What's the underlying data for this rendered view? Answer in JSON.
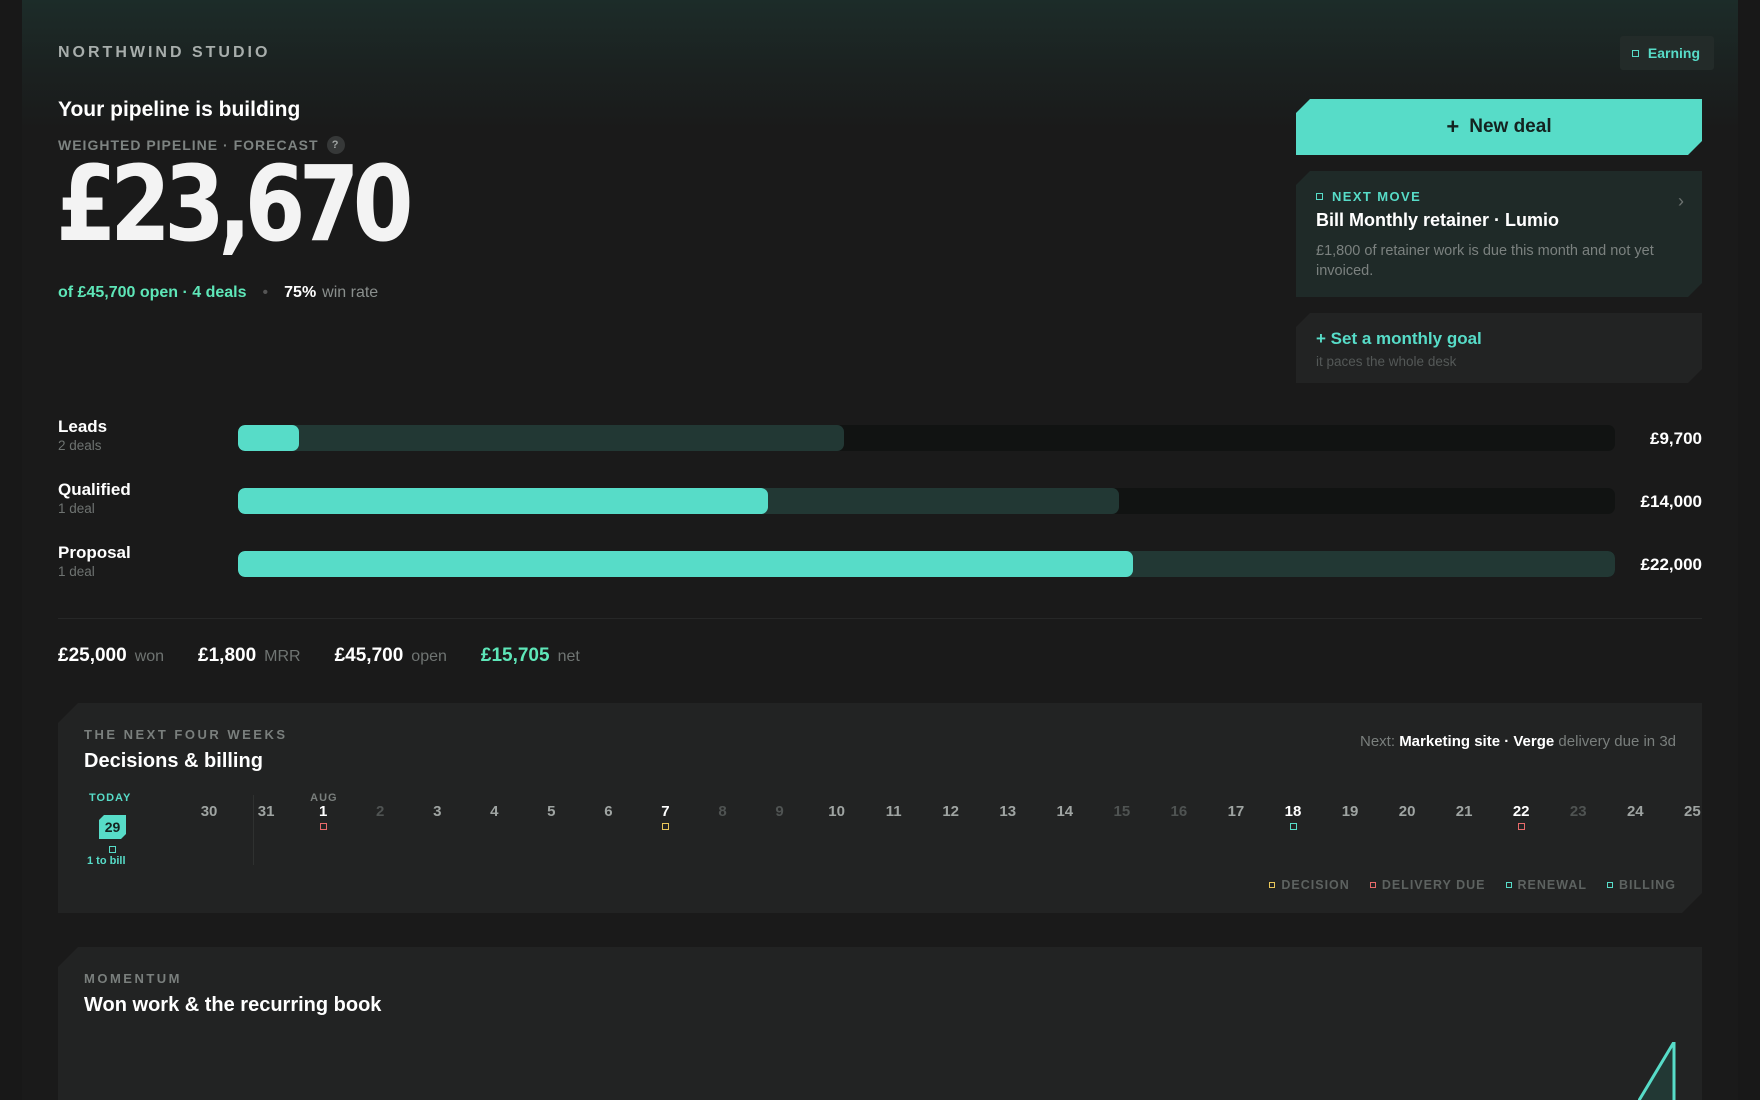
{
  "brand": "NORTHWIND STUDIO",
  "status_badge": "Earning",
  "headline": "Your pipeline is building",
  "forecast": {
    "label": "WEIGHTED PIPELINE · FORECAST",
    "help": "?",
    "value": "£23,670",
    "open_summary": "of £45,700 open · 4 deals",
    "separator": "•",
    "win_rate": "75%",
    "win_rate_label": "win rate"
  },
  "new_deal": {
    "plus": "+",
    "label": "New deal"
  },
  "next_move": {
    "label": "NEXT MOVE",
    "title": "Bill Monthly retainer · Lumio",
    "description": "£1,800 of retainer work is due this month and not yet invoiced.",
    "chevron": "›"
  },
  "goal": {
    "title": "+ Set a monthly goal",
    "subtitle": "it paces the whole desk"
  },
  "stages": [
    {
      "name": "Leads",
      "count": "2 deals",
      "value": "£9,700",
      "total_fraction": 0.44,
      "weighted_fraction": 0.044
    },
    {
      "name": "Qualified",
      "count": "1 deal",
      "value": "£14,000",
      "total_fraction": 0.64,
      "weighted_fraction": 0.385
    },
    {
      "name": "Proposal",
      "count": "1 deal",
      "value": "£22,000",
      "total_fraction": 1.0,
      "weighted_fraction": 0.65
    }
  ],
  "totals": [
    {
      "value": "£25,000",
      "label": "won",
      "color": "#ffffff"
    },
    {
      "value": "£1,800",
      "label": "MRR",
      "color": "#ffffff"
    },
    {
      "value": "£45,700",
      "label": "open",
      "color": "#ffffff"
    },
    {
      "value": "£15,705",
      "label": "net",
      "color": "#5ee6b8"
    }
  ],
  "calendar": {
    "kicker": "THE NEXT FOUR WEEKS",
    "title": "Decisions & billing",
    "next_prefix": "Next:",
    "next_item": "Marketing site · Verge",
    "next_suffix": "delivery due in 3d",
    "today_label": "TODAY",
    "today": "29",
    "today_note": "1 to bill",
    "month_label": "AUG",
    "days": [
      {
        "n": "30",
        "s": "normal"
      },
      {
        "n": "31",
        "s": "normal"
      },
      {
        "n": "1",
        "s": "bright",
        "marker": "delivery"
      },
      {
        "n": "2",
        "s": "dim"
      },
      {
        "n": "3",
        "s": "normal"
      },
      {
        "n": "4",
        "s": "normal"
      },
      {
        "n": "5",
        "s": "normal"
      },
      {
        "n": "6",
        "s": "normal"
      },
      {
        "n": "7",
        "s": "bright",
        "marker": "decision"
      },
      {
        "n": "8",
        "s": "dim"
      },
      {
        "n": "9",
        "s": "dim"
      },
      {
        "n": "10",
        "s": "normal"
      },
      {
        "n": "11",
        "s": "normal"
      },
      {
        "n": "12",
        "s": "normal"
      },
      {
        "n": "13",
        "s": "normal"
      },
      {
        "n": "14",
        "s": "normal"
      },
      {
        "n": "15",
        "s": "dim"
      },
      {
        "n": "16",
        "s": "dim"
      },
      {
        "n": "17",
        "s": "normal"
      },
      {
        "n": "18",
        "s": "bright",
        "marker": "renewal"
      },
      {
        "n": "19",
        "s": "normal"
      },
      {
        "n": "20",
        "s": "normal"
      },
      {
        "n": "21",
        "s": "normal"
      },
      {
        "n": "22",
        "s": "bright",
        "marker": "delivery"
      },
      {
        "n": "23",
        "s": "dim"
      },
      {
        "n": "24",
        "s": "normal"
      },
      {
        "n": "25",
        "s": "normal"
      }
    ],
    "legend": [
      {
        "key": "decision",
        "label": "DECISION",
        "color": "#e8c65a"
      },
      {
        "key": "delivery",
        "label": "DELIVERY DUE",
        "color": "#e86a6a"
      },
      {
        "key": "renewal",
        "label": "RENEWAL",
        "color": "#57dcc8"
      },
      {
        "key": "billing",
        "label": "BILLING",
        "color": "#57dcc8"
      }
    ]
  },
  "momentum": {
    "kicker": "MOMENTUM",
    "title": "Won work & the recurring book"
  },
  "colors": {
    "accent": "#57dcc8",
    "positive": "#5ee6b8"
  }
}
